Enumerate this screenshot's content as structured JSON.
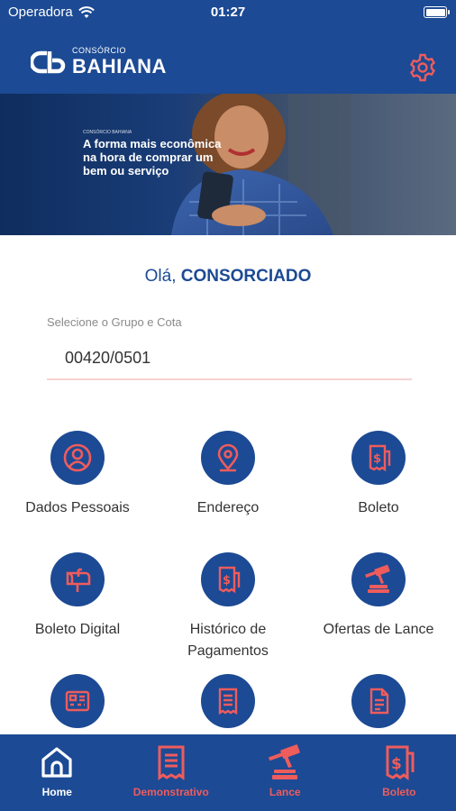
{
  "status_bar": {
    "carrier": "Operadora",
    "time": "01:27"
  },
  "app_bar": {
    "logo_small": "CONSÓRCIO",
    "logo_big": "BAHIANA",
    "settings_icon": "gear-icon"
  },
  "banner": {
    "brand_small": "CONSÓRCIO BAHIANA",
    "tagline": "A forma mais econômica na hora de comprar um bem ou serviço"
  },
  "greeting": {
    "prefix": "Olá, ",
    "name": "CONSORCIADO"
  },
  "selector": {
    "label": "Selecione o Grupo e Cota",
    "value": "00420/0501"
  },
  "menu": [
    {
      "label": "Dados Pessoais",
      "icon": "user-icon"
    },
    {
      "label": "Endereço",
      "icon": "location-pin-icon"
    },
    {
      "label": "Boleto",
      "icon": "receipt-dollar-icon"
    },
    {
      "label": "Boleto Digital",
      "icon": "mailbox-icon"
    },
    {
      "label": "Histórico de Pagamentos",
      "icon": "receipt-dollar-icon"
    },
    {
      "label": "Ofertas de Lance",
      "icon": "auction-hammer-icon"
    },
    {
      "label": "",
      "icon": "calculator-icon"
    },
    {
      "label": "",
      "icon": "receipt-list-icon"
    },
    {
      "label": "",
      "icon": "document-icon"
    }
  ],
  "tabs": [
    {
      "label": "Home",
      "icon": "home-icon",
      "active": true
    },
    {
      "label": "Demonstrativo",
      "icon": "receipt-list-icon",
      "active": false
    },
    {
      "label": "Lance",
      "icon": "auction-hammer-icon",
      "active": false
    },
    {
      "label": "Boleto",
      "icon": "receipt-dollar-icon",
      "active": false
    }
  ],
  "colors": {
    "primary": "#1c4a94",
    "accent": "#ee5c5c",
    "text": "#333333",
    "underline": "#f7d3d3"
  }
}
